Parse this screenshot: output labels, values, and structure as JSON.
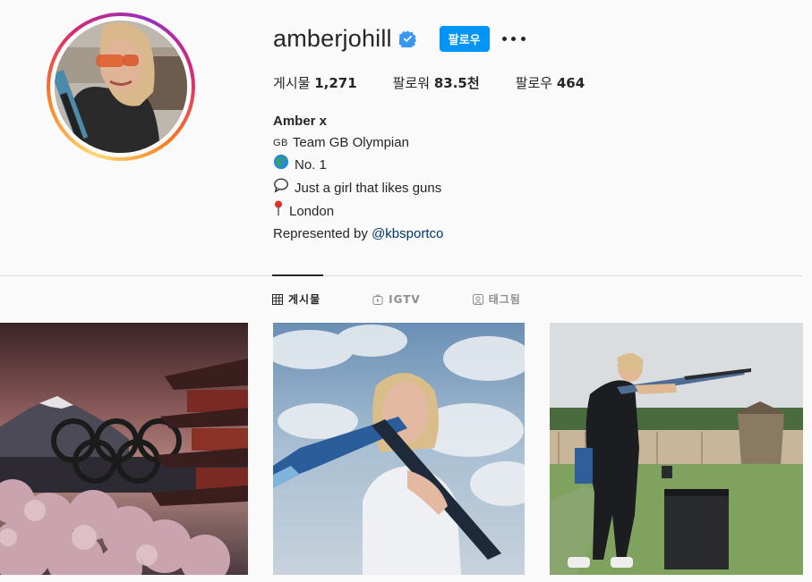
{
  "profile": {
    "username": "amberjohill",
    "follow_label": "팔로우",
    "more_label": "options",
    "stats": {
      "posts_label": "게시물",
      "posts_value": "1,271",
      "followers_label": "팔로워",
      "followers_value": "83.5천",
      "following_label": "팔로우",
      "following_value": "464"
    },
    "bio": {
      "name": "Amber x",
      "line1_flag": "GB",
      "line1_text": "Team GB Olympian",
      "line2_text": "No. 1",
      "line3_text": "Just a girl that likes guns",
      "line4_text": "London",
      "line5_prefix": "Represented by",
      "line5_link": "@kbsportco"
    }
  },
  "tabs": [
    {
      "label": "게시물",
      "icon": "grid-icon",
      "active": true
    },
    {
      "label": "IGTV",
      "icon": "igtv-icon",
      "active": false
    },
    {
      "label": "태그됨",
      "icon": "tagged-icon",
      "active": false
    }
  ],
  "colors": {
    "accent": "#0095f6",
    "link": "#00376b",
    "verified": "#3897f0"
  }
}
